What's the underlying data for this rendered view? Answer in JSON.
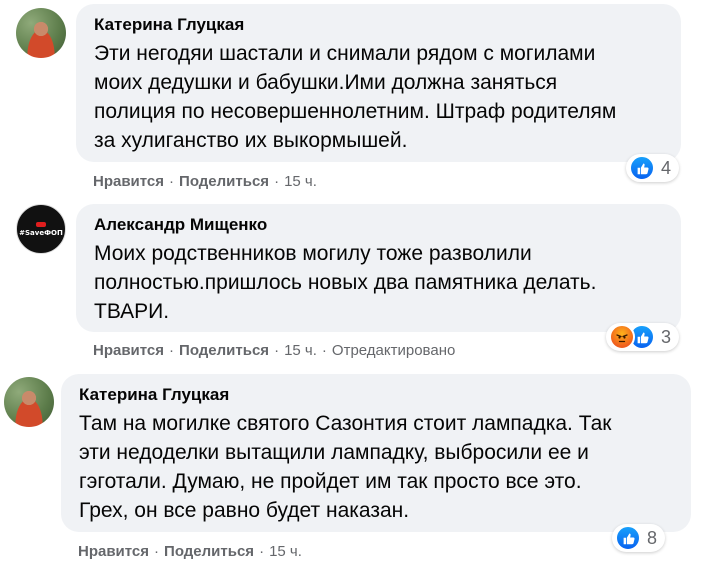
{
  "comments": [
    {
      "author": "Катерина Глуцкая",
      "lines": [
        "Эти негодяи шастали и снимали рядом с могилами",
        "моих дедушки и бабушки.Ими должна заняться",
        "полиция по несовершеннолетним. Штраф родителям",
        "за хулиганство их выкормышей."
      ],
      "like_label": "Нравится",
      "share_label": "Поделиться",
      "time": "15 ч.",
      "reaction_count": "4"
    },
    {
      "author": "Александр Мищенко",
      "avatar_text": "#SaveФОП",
      "lines": [
        "Моих родственников могилу тоже разволили",
        "полностью.пришлось новых два памятника делать.",
        "ТВАРИ."
      ],
      "like_label": "Нравится",
      "share_label": "Поделиться",
      "time": "15 ч.",
      "edited": "Отредактировано",
      "reaction_count": "3"
    },
    {
      "author": "Катерина Глуцкая",
      "lines": [
        "Там на могилке святого Сазонтия стоит лампадка. Так",
        "эти недоделки вытащили лампадку, выбросили ее и",
        "гэготали. Думаю, не пройдет им так просто все это.",
        "Грех, он все равно будет наказан."
      ],
      "like_label": "Нравится",
      "share_label": "Поделиться",
      "time": "15 ч.",
      "reaction_count": "8"
    }
  ],
  "separator": "·",
  "colors": {
    "bubble": "#f0f2f5",
    "meta_text": "#65676b",
    "like_blue": "#0862f0",
    "angry_orange": "#f05f1e"
  }
}
